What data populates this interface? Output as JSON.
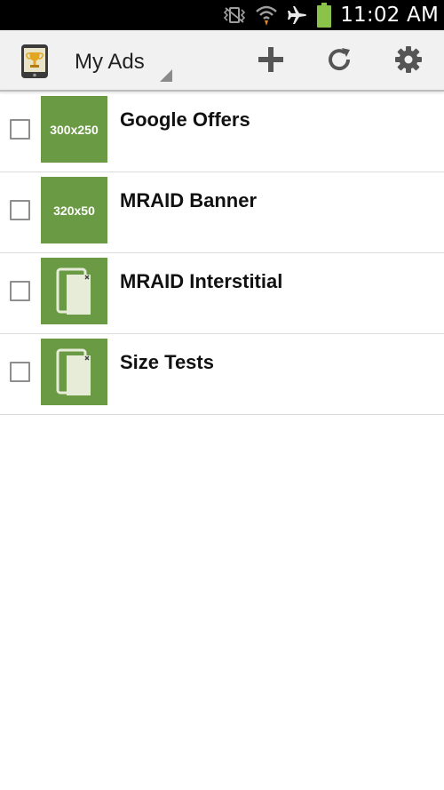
{
  "status_bar": {
    "time": "11:02 AM",
    "icons": [
      "vibrate-icon",
      "wifi-icon",
      "airplane-icon",
      "battery-icon"
    ]
  },
  "action_bar": {
    "title": "My Ads",
    "actions": [
      "add-icon",
      "refresh-icon",
      "settings-icon"
    ]
  },
  "ads": [
    {
      "name": "Google Offers",
      "thumb_type": "size",
      "thumb_label": "300x250",
      "checked": false
    },
    {
      "name": "MRAID Banner",
      "thumb_type": "size",
      "thumb_label": "320x50",
      "checked": false
    },
    {
      "name": "MRAID Interstitial",
      "thumb_type": "interstitial",
      "thumb_label": "",
      "checked": false
    },
    {
      "name": "Size Tests",
      "thumb_type": "interstitial",
      "thumb_label": "",
      "checked": false
    }
  ],
  "colors": {
    "thumb_green": "#6a9a44",
    "battery_green": "#8bc34a",
    "action_icon": "#555555"
  }
}
